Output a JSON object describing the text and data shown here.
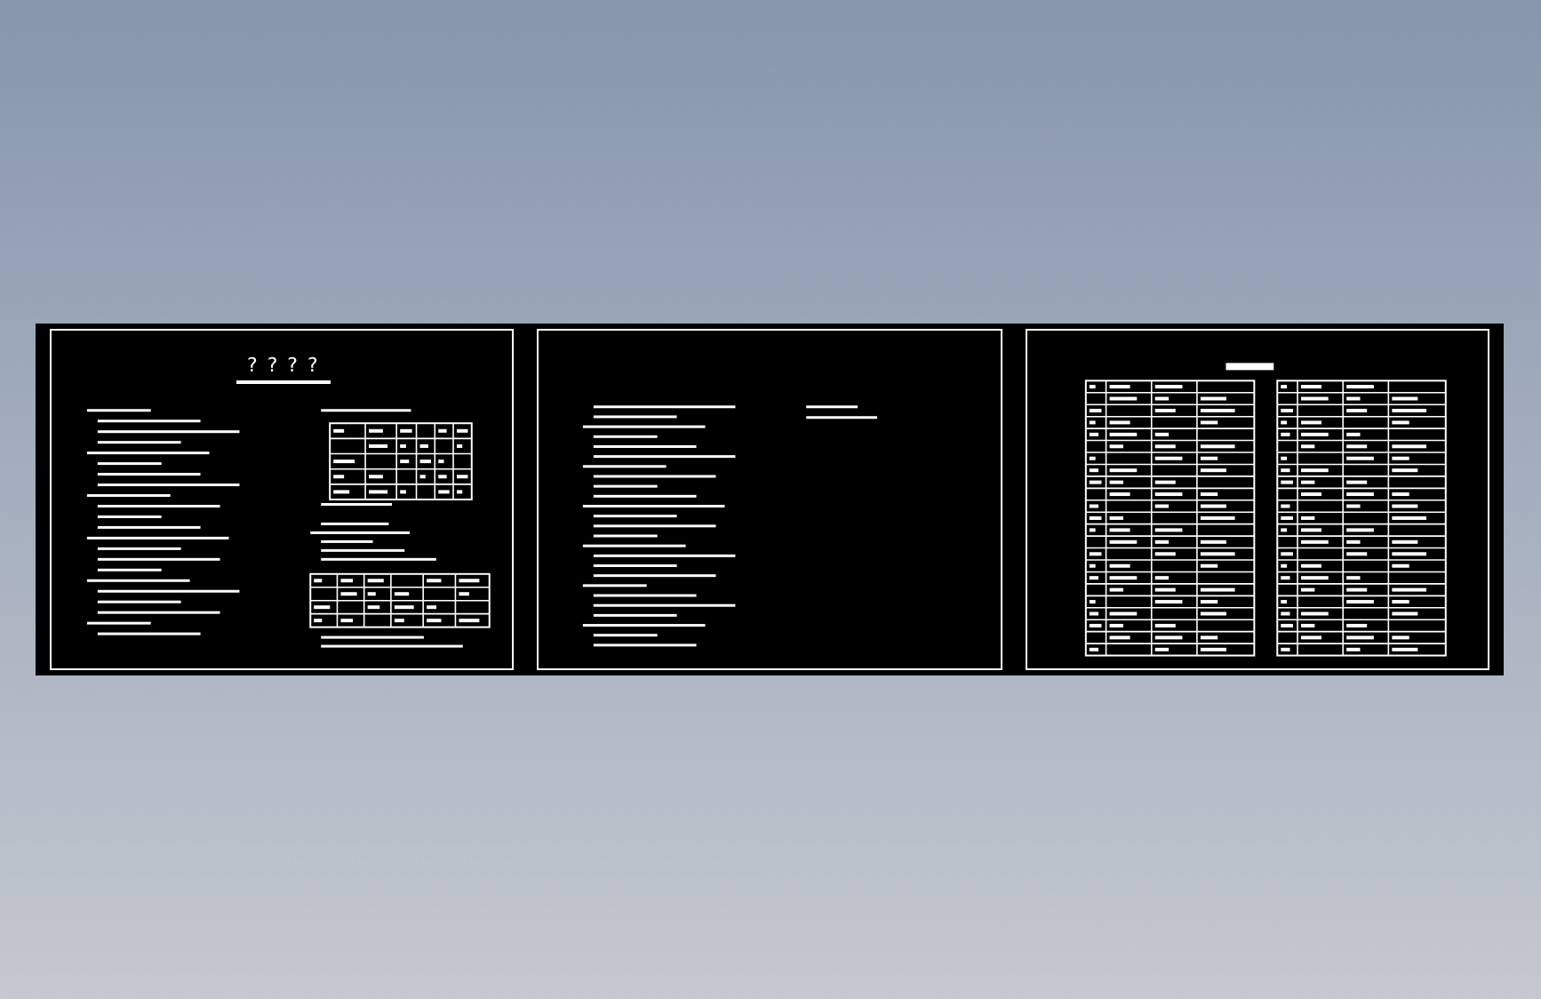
{
  "sheets": [
    {
      "kind": "notes",
      "title": "? ? ? ?"
    },
    {
      "kind": "notes"
    },
    {
      "kind": "legend"
    }
  ]
}
